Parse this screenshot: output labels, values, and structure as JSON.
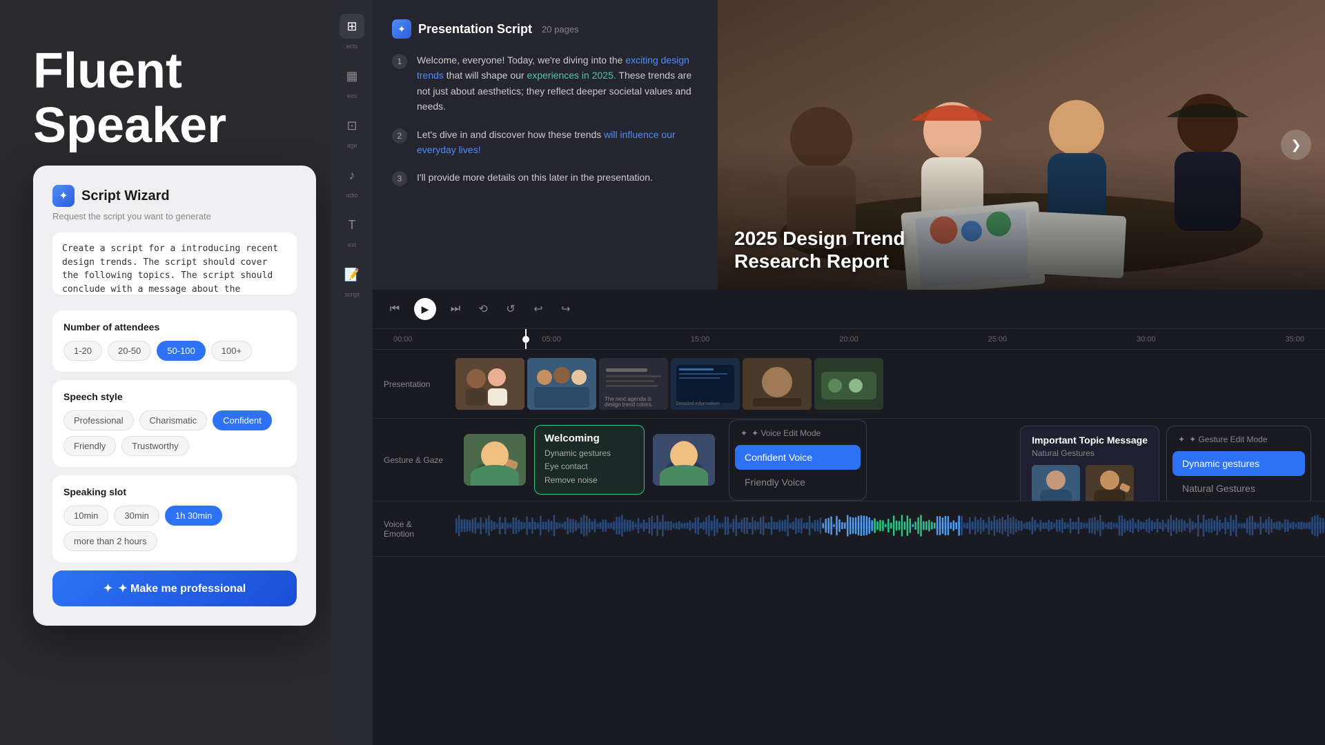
{
  "brand": {
    "line1": "Fluent",
    "line2": "Speaker"
  },
  "wizard": {
    "title": "Script Wizard",
    "subtitle": "Request the script you want to generate",
    "textarea_value": "Create a script for a introducing recent design trends. The script should cover the following topics. The script should conclude with a message about the importance of innovation, responsibility, and creativity in shaping the future of design.",
    "sections": {
      "attendees": {
        "title": "Number of attendees",
        "options": [
          "1-20",
          "20-50",
          "50-100",
          "100+"
        ],
        "active": "50-100"
      },
      "speech_style": {
        "title": "Speech style",
        "options": [
          "Professional",
          "Charismatic",
          "Confident",
          "Friendly",
          "Trustworthy"
        ],
        "active": "Confident"
      },
      "speaking_slot": {
        "title": "Speaking slot",
        "options": [
          "10min",
          "30min",
          "1h 30min",
          "more than 2 hours"
        ],
        "active": "1h 30min"
      }
    },
    "cta_label": "✦ Make me professional"
  },
  "script_panel": {
    "title": "Presentation Script",
    "pages": "20 pages",
    "items": [
      {
        "num": "1",
        "text_before": "Welcome, everyone! Today, we're diving into the ",
        "highlight1": "exciting design trends",
        "text_mid": " that will shape our ",
        "highlight2": "experiences in 2025.",
        "text_after": " These trends are not just about aesthetics; they reflect deeper societal values and needs."
      },
      {
        "num": "2",
        "text_before": "Let's dive in and discover how these trends ",
        "highlight1": "will influence our everyday lives!",
        "text_after": ""
      },
      {
        "num": "3",
        "text_plain": "I'll provide more details on this later in the presentation."
      }
    ]
  },
  "image_panel": {
    "title": "2025 Design Trend",
    "subtitle": "Research Report"
  },
  "timeline": {
    "time_markers": [
      "00:00",
      "05:00",
      "15:00",
      "20:00",
      "25:00",
      "30:00",
      "35:00"
    ],
    "tracks": {
      "presentation": "Presentation",
      "gesture": "Gesture & Gaze",
      "voice": "Voice & Emotion"
    },
    "slide_texts": [
      "",
      "The next agenda is design trend colors.",
      "Detailed information can be thro...",
      ""
    ]
  },
  "gesture_track": {
    "welcoming_label": "Welcoming",
    "details": [
      "Dynamic gestures",
      "Eye contact",
      "Remove noise"
    ]
  },
  "voice_dropdown": {
    "header": "✦ Voice Edit Mode",
    "options": [
      "Confident Voice",
      "Friendly Voice"
    ],
    "active": "Confident Voice"
  },
  "gesture_dropdown": {
    "header": "✦ Gesture Edit Mode",
    "options": [
      "Dynamic gestures",
      "Natural Gestures"
    ],
    "active": "Dynamic gestures"
  },
  "topic_message": {
    "title": "Important Topic Message",
    "subtitle": "Natural Gestures"
  },
  "icons": {
    "star": "✦",
    "play": "▶",
    "prev": "⏮",
    "next": "⏭",
    "step_back": "⏪",
    "step_fwd": "⏩",
    "undo": "↩",
    "redo": "↪",
    "chevron_right": "❯",
    "projects": "⊞",
    "videos": "▦",
    "image": "⊡",
    "audio": "♪",
    "text": "T",
    "more": "⋯"
  },
  "colors": {
    "accent_blue": "#2d72f5",
    "accent_teal": "#2dc87a",
    "bg_dark": "#1a1a22",
    "bg_mid": "#252530",
    "highlight_blue": "#4f8ef7",
    "highlight_teal": "#4fcba0"
  }
}
